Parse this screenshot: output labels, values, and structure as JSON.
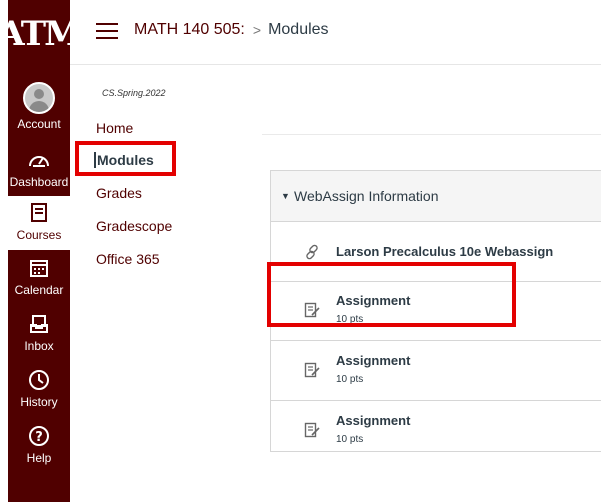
{
  "global_nav": {
    "logo_text": "ATM",
    "items": [
      {
        "label": "Account",
        "icon": "account-avatar-icon"
      },
      {
        "label": "Dashboard",
        "icon": "dashboard-gauge-icon"
      },
      {
        "label": "Courses",
        "icon": "courses-book-icon"
      },
      {
        "label": "Calendar",
        "icon": "calendar-icon"
      },
      {
        "label": "Inbox",
        "icon": "inbox-icon"
      },
      {
        "label": "History",
        "icon": "history-clock-icon"
      },
      {
        "label": "Help",
        "icon": "help-question-icon"
      }
    ],
    "brand_color": "#500000"
  },
  "header": {
    "course": "MATH 140 505:",
    "separator": ">",
    "current": "Modules"
  },
  "course_nav": {
    "term": "CS.Spring.2022",
    "items": [
      "Home",
      "Modules",
      "Grades",
      "Gradescope",
      "Office 365"
    ],
    "active": "Modules"
  },
  "module": {
    "title": "WebAssign Information",
    "items": [
      {
        "title": "Larson Precalculus 10e Webassign",
        "icon": "link-icon",
        "points": ""
      },
      {
        "title": "Assignment",
        "icon": "assignment-icon",
        "points": "10 pts"
      },
      {
        "title": "Assignment",
        "icon": "assignment-icon",
        "points": "10 pts"
      },
      {
        "title": "Assignment",
        "icon": "assignment-icon",
        "points": "10 pts"
      }
    ]
  },
  "highlight_color": "#e30000"
}
